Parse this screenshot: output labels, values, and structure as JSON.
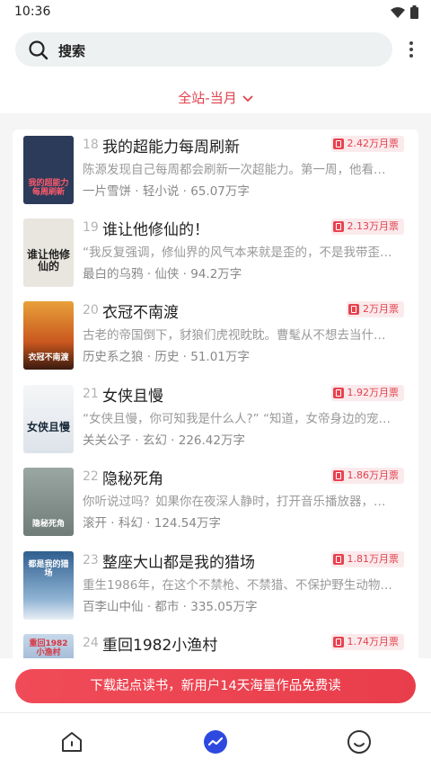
{
  "status": {
    "time": "10:36"
  },
  "search": {
    "label": "搜索"
  },
  "filter": {
    "label": "全站-当月"
  },
  "books": [
    {
      "rank": "18",
      "title": "我的超能力每周刷新",
      "votes": "2.42万月票",
      "desc": "陈源发现自己每周都会刷新一次超能力。第一周，他看…",
      "meta": "一片雪饼 · 轻小说 · 65.07万字",
      "cover_text": "我的超能力每周刷新",
      "cover_bg": "#2c3b5a"
    },
    {
      "rank": "19",
      "title": "谁让他修仙的！",
      "votes": "2.13万月票",
      "desc": "“我反复强调，修仙界的风气本来就是歪的，不是我带歪…",
      "meta": "最白的乌鸦 · 仙侠 · 94.2万字",
      "cover_text": "谁让他修仙的",
      "cover_bg": "#e9e6df"
    },
    {
      "rank": "20",
      "title": "衣冠不南渡",
      "votes": "2万月票",
      "desc": "古老的帝国倒下，豺狼们虎视眈眈。曹髦从不想去当什…",
      "meta": "历史系之狼 · 历史 · 51.01万字",
      "cover_text": "衣冠不南渡",
      "cover_bg": "#c9571e"
    },
    {
      "rank": "21",
      "title": "女侠且慢",
      "votes": "1.92万月票",
      "desc": "“女侠且慢，你可知我是什么人?” “知道，女帝身边的宠…",
      "meta": "关关公子 · 玄幻 · 226.42万字",
      "cover_text": "女侠且慢",
      "cover_bg": "#eef0f2"
    },
    {
      "rank": "22",
      "title": "隐秘死角",
      "votes": "1.86万月票",
      "desc": "你听说过吗？如果你在夜深人静时，打开音乐播放器，…",
      "meta": "滚开 · 科幻 · 124.54万字",
      "cover_text": "隐秘死角",
      "cover_bg": "#7c8a86"
    },
    {
      "rank": "23",
      "title": "整座大山都是我的猎场",
      "votes": "1.81万月票",
      "desc": "重生1986年，在这个不禁枪、不禁猎、不保护野生动物…",
      "meta": "百李山中仙 · 都市 · 335.05万字",
      "cover_text": "都是我的猎场",
      "cover_bg": "#3f6f9d"
    },
    {
      "rank": "24",
      "title": "重回1982小渔村",
      "votes": "1.74万月票",
      "desc": "",
      "meta": "",
      "cover_text": "重回1982小渔村",
      "cover_bg": "#6d8fb8"
    }
  ],
  "cta": {
    "label": "下载起点读书，新用户14天海量作品免费读"
  },
  "nav": {
    "active_color": "#2d49e0"
  },
  "colors": {
    "accent": "#e0414d",
    "badge_bg": "#fbeaec"
  }
}
